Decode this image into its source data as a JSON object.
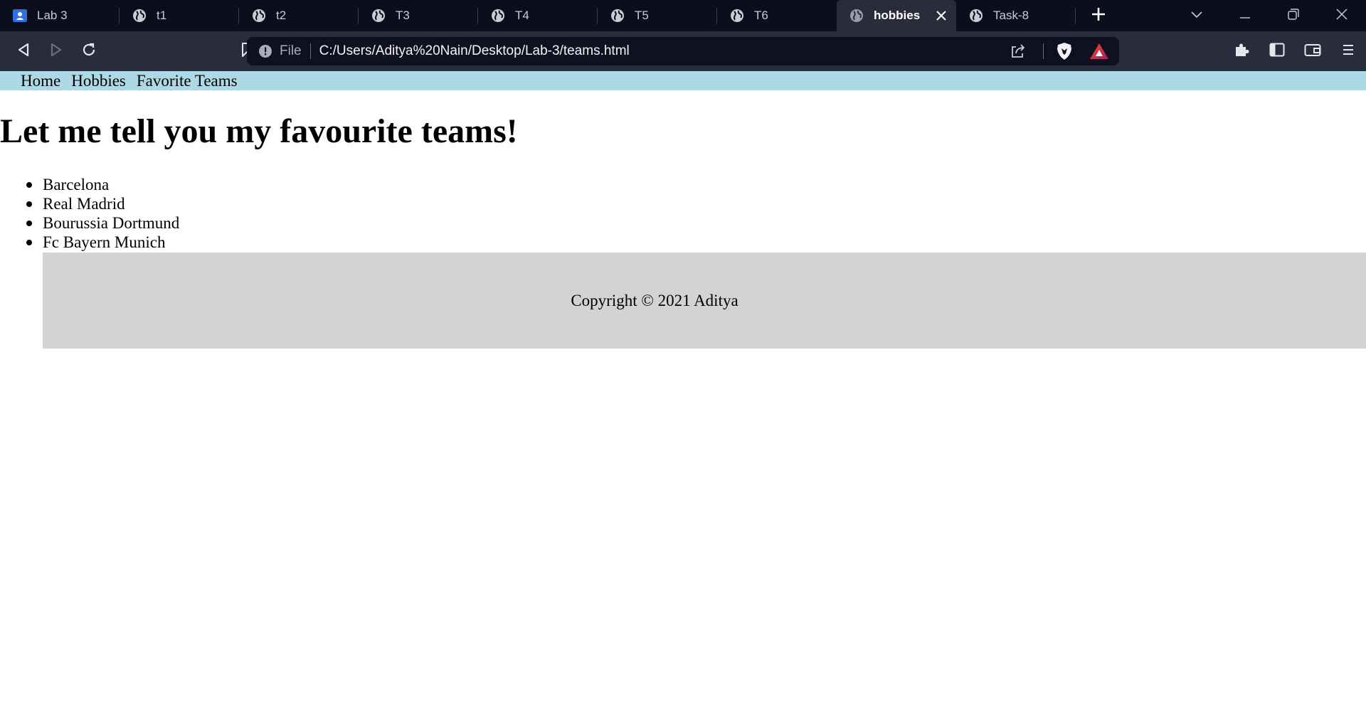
{
  "browser": {
    "tabs": [
      {
        "title": "Lab 3",
        "icon": "classroom-icon",
        "active": false
      },
      {
        "title": "t1",
        "icon": "globe-icon",
        "active": false
      },
      {
        "title": "t2",
        "icon": "globe-icon",
        "active": false
      },
      {
        "title": "T3",
        "icon": "globe-icon",
        "active": false
      },
      {
        "title": "T4",
        "icon": "globe-icon",
        "active": false
      },
      {
        "title": "T5",
        "icon": "globe-icon",
        "active": false
      },
      {
        "title": "T6",
        "icon": "globe-icon",
        "active": false
      },
      {
        "title": "hobbies",
        "icon": "globe-icon",
        "active": true
      },
      {
        "title": "Task-8",
        "icon": "globe-icon",
        "active": false
      }
    ],
    "address": {
      "scheme_label": "File",
      "url": "C:/Users/Aditya%20Nain/Desktop/Lab-3/teams.html"
    },
    "colors": {
      "tabstrip_bg": "#0d0e1b",
      "toolbar_bg": "#2a2c3b",
      "omnibox_bg": "#0f1020",
      "classroom_blue": "#2f6fe4",
      "brave_orange": "#f2f2f2",
      "bat_gradient_start": "#ff4724",
      "bat_gradient_end": "#9e1f63"
    }
  },
  "page": {
    "nav": {
      "items": [
        "Home",
        "Hobbies",
        "Favorite Teams"
      ],
      "background": "#add8e6"
    },
    "heading": "Let me tell you my favourite teams!",
    "teams": [
      "Barcelona",
      "Real Madrid",
      "Bourussia Dortmund",
      "Fc Bayern Munich"
    ],
    "footer": {
      "text": "Copyright © 2021 Aditya",
      "background": "#d3d3d3"
    }
  }
}
